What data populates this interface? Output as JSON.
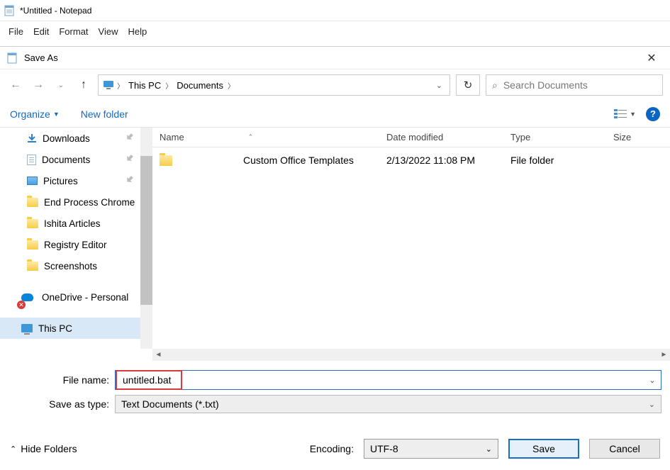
{
  "notepad": {
    "title": "*Untitled - Notepad",
    "menu": [
      "File",
      "Edit",
      "Format",
      "View",
      "Help"
    ]
  },
  "dialog": {
    "title": "Save As",
    "breadcrumb": {
      "root_icon": "pc-icon",
      "parts": [
        "This PC",
        "Documents"
      ]
    },
    "search_placeholder": "Search Documents",
    "organize_label": "Organize",
    "new_folder_label": "New folder",
    "sidebar": [
      {
        "name": "Downloads",
        "icon": "download-icon",
        "pinned": true
      },
      {
        "name": "Documents",
        "icon": "document-icon",
        "pinned": true
      },
      {
        "name": "Pictures",
        "icon": "pictures-icon",
        "pinned": true
      },
      {
        "name": "End Process Chrome",
        "icon": "folder-icon",
        "pinned": false
      },
      {
        "name": "Ishita Articles",
        "icon": "folder-icon",
        "pinned": false
      },
      {
        "name": "Registry Editor",
        "icon": "folder-icon",
        "pinned": false
      },
      {
        "name": "Screenshots",
        "icon": "folder-icon",
        "pinned": false
      },
      {
        "name": "OneDrive - Personal",
        "icon": "onedrive-icon",
        "pinned": false,
        "error": true,
        "level": 2
      },
      {
        "name": "This PC",
        "icon": "pc-icon",
        "pinned": false,
        "selected": true,
        "level": 2
      }
    ],
    "columns": {
      "name": "Name",
      "date": "Date modified",
      "type": "Type",
      "size": "Size"
    },
    "rows": [
      {
        "name": "Custom Office Templates",
        "date": "2/13/2022 11:08 PM",
        "type": "File folder",
        "size": ""
      }
    ],
    "file_name_label": "File name:",
    "file_name_value": "untitled.bat",
    "save_type_label": "Save as type:",
    "save_type_value": "Text Documents (*.txt)",
    "encoding_label": "Encoding:",
    "encoding_value": "UTF-8",
    "save_button": "Save",
    "cancel_button": "Cancel",
    "hide_folders": "Hide Folders"
  }
}
